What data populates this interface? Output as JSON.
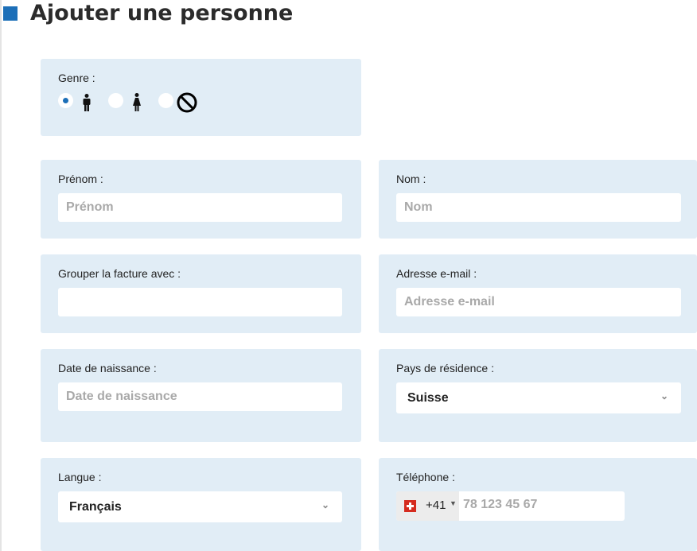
{
  "page": {
    "title": "Ajouter une personne"
  },
  "colors": {
    "accent": "#1c6fb8",
    "card_bg": "#e1edf6",
    "placeholder": "#a9a9a9"
  },
  "gender": {
    "label": "Genre :",
    "options": [
      {
        "icon": "male-icon",
        "selected": true
      },
      {
        "icon": "female-icon",
        "selected": false
      },
      {
        "icon": "prohibited-icon",
        "selected": false
      }
    ]
  },
  "first_name": {
    "label": "Prénom :",
    "placeholder": "Prénom"
  },
  "last_name": {
    "label": "Nom :",
    "placeholder": "Nom"
  },
  "group_invoice": {
    "label": "Grouper la facture avec :",
    "value": ""
  },
  "email": {
    "label": "Adresse e-mail :",
    "placeholder": "Adresse e-mail"
  },
  "birth_date": {
    "label": "Date de naissance :",
    "placeholder": "Date de naissance"
  },
  "country": {
    "label": "Pays de résidence :",
    "value": "Suisse"
  },
  "language": {
    "label": "Langue :",
    "value": "Français"
  },
  "phone": {
    "label": "Téléphone :",
    "country_flag": "swiss-flag-icon",
    "dial_code": "+41",
    "placeholder": "78 123 45 67"
  }
}
